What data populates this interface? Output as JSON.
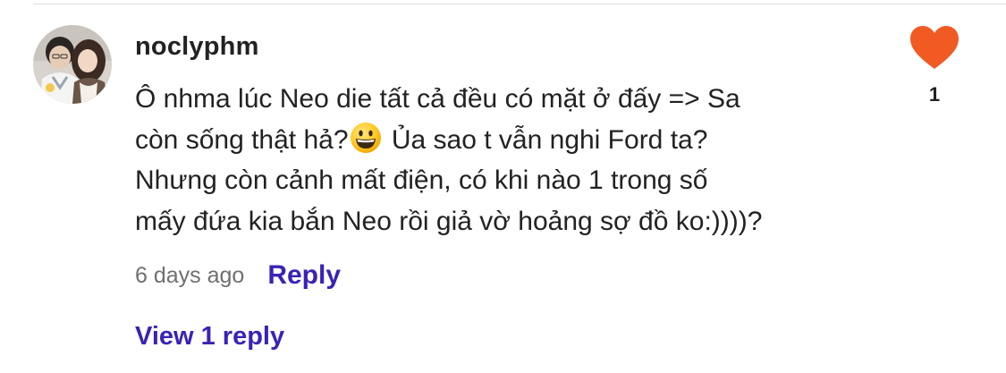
{
  "comment": {
    "username": "noclyphm",
    "text_lines": [
      "Ô nhma lúc Neo die tất cả đều có mặt ở đấy => Sa",
      "còn sống thật hả?",
      " Ủa sao t vẫn nghi Ford ta?",
      "Nhưng còn cảnh mất điện, có khi nào 1 trong số",
      "mấy đứa kia bắn Neo rồi giả vờ hoảng sợ đồ ko:))))?"
    ],
    "emoji": "grinning-face-emoji",
    "timestamp": "6 days ago",
    "reply_label": "Reply",
    "view_replies_label": "View 1 reply",
    "like_count": "1",
    "liked": true
  },
  "colors": {
    "accent": "#3b22b5",
    "heart": "#f25a24",
    "text": "#222222",
    "muted": "#6f6f6f"
  }
}
